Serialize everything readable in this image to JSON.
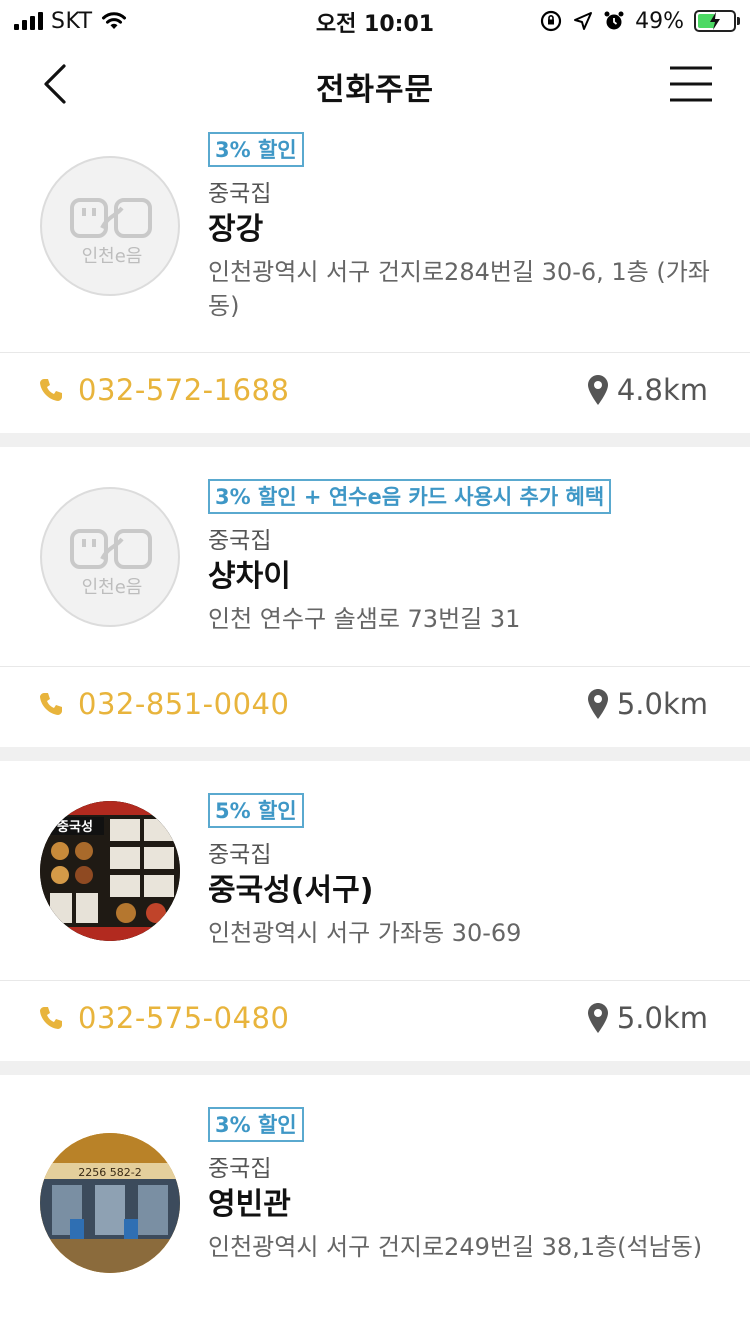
{
  "status_bar": {
    "carrier": "SKT",
    "time": "오전 10:01",
    "battery": "49%",
    "battery_level": 0.49
  },
  "nav": {
    "title": "전화주문"
  },
  "restaurants": [
    {
      "badge": "3% 할인",
      "category": "중국집",
      "name": "장강",
      "address": "인천광역시 서구 건지로284번길 30-6, 1층 (가좌동)",
      "phone": "032-572-1688",
      "distance": "4.8km",
      "thumb": "logo",
      "logo_text": "인천e음"
    },
    {
      "badge": "3% 할인 + 연수e음 카드 사용시 추가 혜택",
      "category": "중국집",
      "name": "샹차이",
      "address": "인천 연수구 솔샘로 73번길 31",
      "phone": "032-851-0040",
      "distance": "5.0km",
      "thumb": "logo",
      "logo_text": "인천e음"
    },
    {
      "badge": "5% 할인",
      "category": "중국집",
      "name": "중국성(서구)",
      "address": "인천광역시 서구 가좌동 30-69",
      "phone": "032-575-0480",
      "distance": "5.0km",
      "thumb": "menu-photo",
      "photo_text": "중국성"
    },
    {
      "badge": "3% 할인",
      "category": "중국집",
      "name": "영빈관",
      "address": "인천광역시 서구 건지로249번길 38,1층(석남동)",
      "thumb": "storefront-photo",
      "photo_text": "2256 582-2"
    }
  ],
  "colors": {
    "badge_blue": "#3e97c6",
    "phone_orange": "#e8b43c",
    "separator_gray": "#f0f0f0"
  },
  "icons": {
    "back": "chevron-left-icon",
    "menu": "hamburger-menu-icon",
    "phone": "phone-icon",
    "location": "map-pin-icon"
  }
}
